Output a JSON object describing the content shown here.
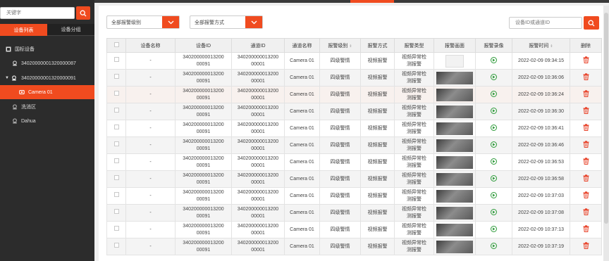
{
  "sidebar": {
    "keyword_placeholder": "关键字",
    "tabs": [
      {
        "label": "设备列表",
        "active": true
      },
      {
        "label": "设备分组",
        "active": false
      }
    ],
    "tree": [
      {
        "label": "国标设备",
        "level": 0,
        "icon": "folder-icon"
      },
      {
        "label": "34020000001320000087",
        "level": 1,
        "icon": "device-icon"
      },
      {
        "label": "34020000001320000091",
        "level": 1,
        "icon": "device-icon"
      },
      {
        "label": "Camera 01",
        "level": 2,
        "icon": "camera-icon",
        "selected": true
      },
      {
        "label": "洗消区",
        "level": 1,
        "icon": "device-icon"
      },
      {
        "label": "Dahua",
        "level": 1,
        "icon": "device-icon"
      }
    ]
  },
  "filters": {
    "level_select": "全部报警级别",
    "method_select": "全部报警方式",
    "search_placeholder": "设备ID或通道ID"
  },
  "table": {
    "headers": [
      "设备名称",
      "设备ID",
      "通道ID",
      "通道名称",
      "报警级别",
      "报警方式",
      "报警类型",
      "报警画面",
      "报警录像",
      "报警时间",
      "删除"
    ],
    "rows": [
      {
        "name": "-",
        "device_id": "34020000001320000091",
        "channel_id": "34020000001320000001",
        "channel_name": "Camera 01",
        "level": "四级警情",
        "method": "视频报警",
        "type": "视频异常检测报警",
        "time": "2022-02-09 09:34:15",
        "pic": "empty"
      },
      {
        "name": "-",
        "device_id": "34020000001320000091",
        "channel_id": "34020000001320000001",
        "channel_name": "Camera 01",
        "level": "四级警情",
        "method": "视频报警",
        "type": "视频异常检测报警",
        "time": "2022-02-09 10:36:06",
        "pic": "image"
      },
      {
        "name": "-",
        "device_id": "34020000001320000091",
        "channel_id": "34020000001320000001",
        "channel_name": "Camera 01",
        "level": "四级警情",
        "method": "视频报警",
        "type": "视频异常检测报警",
        "time": "2022-02-09 10:36:24",
        "pic": "image"
      },
      {
        "name": "-",
        "device_id": "34020000001320000091",
        "channel_id": "34020000001320000001",
        "channel_name": "Camera 01",
        "level": "四级警情",
        "method": "视频报警",
        "type": "视频异常检测报警",
        "time": "2022-02-09 10:36:30",
        "pic": "image"
      },
      {
        "name": "-",
        "device_id": "34020000001320000091",
        "channel_id": "34020000001320000001",
        "channel_name": "Camera 01",
        "level": "四级警情",
        "method": "视频报警",
        "type": "视频异常检测报警",
        "time": "2022-02-09 10:36:41",
        "pic": "image"
      },
      {
        "name": "-",
        "device_id": "34020000001320000091",
        "channel_id": "34020000001320000001",
        "channel_name": "Camera 01",
        "level": "四级警情",
        "method": "视频报警",
        "type": "视频异常检测报警",
        "time": "2022-02-09 10:36:46",
        "pic": "image"
      },
      {
        "name": "-",
        "device_id": "34020000001320000091",
        "channel_id": "34020000001320000001",
        "channel_name": "Camera 01",
        "level": "四级警情",
        "method": "视频报警",
        "type": "视频异常检测报警",
        "time": "2022-02-09 10:36:53",
        "pic": "image"
      },
      {
        "name": "-",
        "device_id": "34020000001320000091",
        "channel_id": "34020000001320000001",
        "channel_name": "Camera 01",
        "level": "四级警情",
        "method": "视频报警",
        "type": "视频异常检测报警",
        "time": "2022-02-09 10:36:58",
        "pic": "image"
      },
      {
        "name": "-",
        "device_id": "34020000001320000091",
        "channel_id": "34020000001320000001",
        "channel_name": "Camera 01",
        "level": "四级警情",
        "method": "视频报警",
        "type": "视频异常检测报警",
        "time": "2022-02-09 10:37:03",
        "pic": "image"
      },
      {
        "name": "-",
        "device_id": "34020000001320000091",
        "channel_id": "34020000001320000001",
        "channel_name": "Camera 01",
        "level": "四级警情",
        "method": "视频报警",
        "type": "视频异常检测报警",
        "time": "2022-02-09 10:37:08",
        "pic": "image"
      },
      {
        "name": "-",
        "device_id": "34020000001320000091",
        "channel_id": "34020000001320000001",
        "channel_name": "Camera 01",
        "level": "四级警情",
        "method": "视频报警",
        "type": "视频异常检测报警",
        "time": "2022-02-09 10:37:13",
        "pic": "image"
      },
      {
        "name": "-",
        "device_id": "34020000001320000091",
        "channel_id": "34020000001320000001",
        "channel_name": "Camera 01",
        "level": "四级警情",
        "method": "视频报警",
        "type": "视频异常检测报警",
        "time": "2022-02-09 10:37:19",
        "pic": "image"
      }
    ]
  },
  "colors": {
    "accent": "#f04b1f",
    "sidebar_bg": "#2c2c2c",
    "play_green": "#2e9b3a",
    "delete_red": "#e8452c"
  }
}
